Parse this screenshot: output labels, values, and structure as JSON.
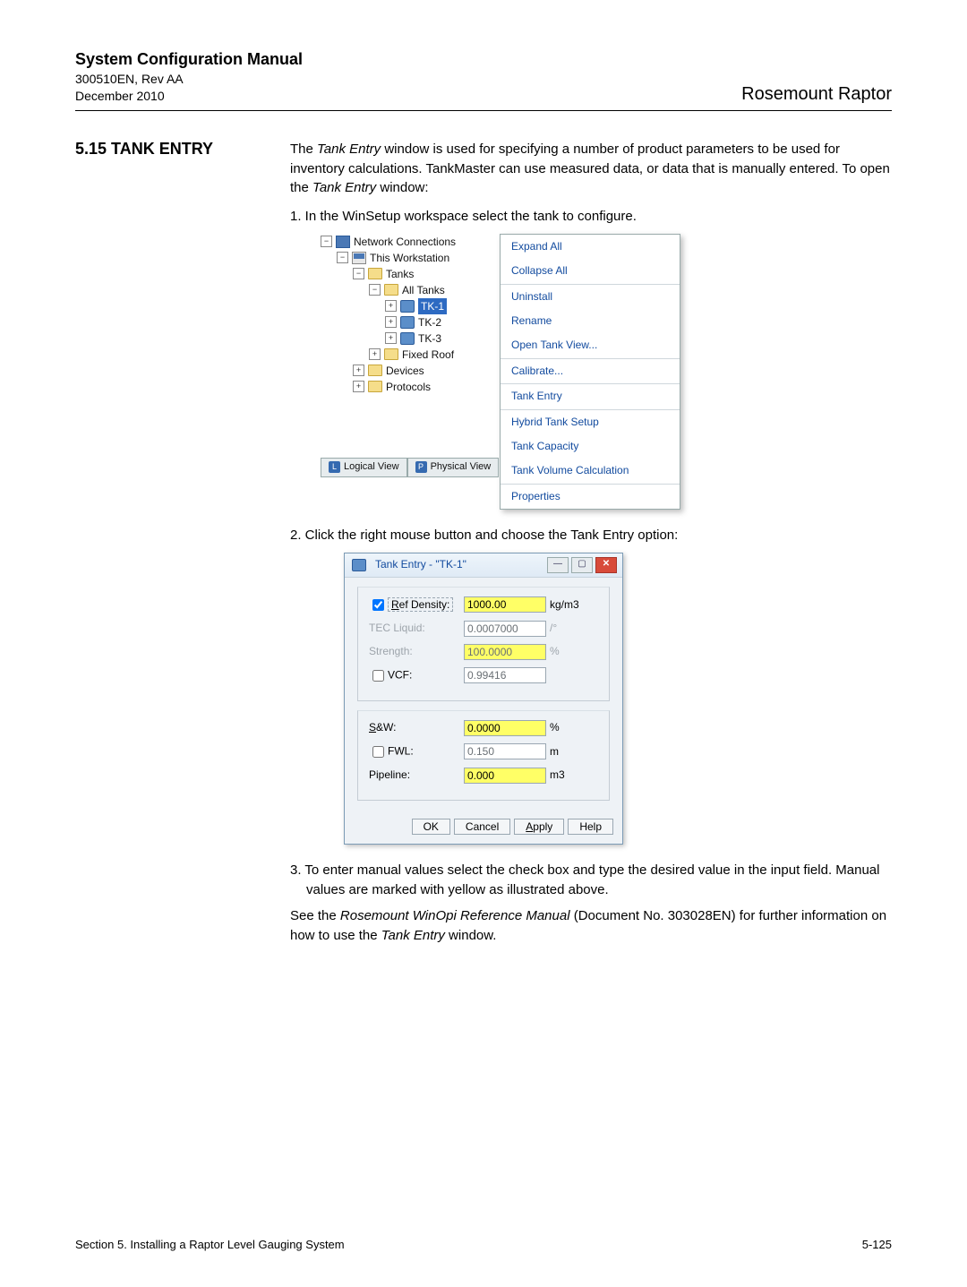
{
  "header": {
    "title": "System Configuration Manual",
    "doc_id": "300510EN, Rev AA",
    "date": "December 2010",
    "brand": "Rosemount Raptor"
  },
  "section": {
    "number_title": "5.15 TANK ENTRY",
    "intro1_a": "The ",
    "intro1_em": "Tank Entry",
    "intro1_b": " window is used for specifying a number of product parameters to be used for inventory calculations. TankMaster can use measured data, or data that is manually entered. To open the ",
    "intro1_em2": "Tank Entry",
    "intro1_c": " window:",
    "step1": "1.  In the WinSetup workspace select the tank to configure.",
    "step2": "2.  Click the right mouse button and choose the Tank Entry option:",
    "step3": "3.  To enter manual values select the check box and type the desired value in the input field. Manual values are marked with yellow as illustrated above.",
    "closing_a": "See the ",
    "closing_em": "Rosemount WinOpi Reference Manual",
    "closing_b": " (Document No. 303028EN) for further information on how to use the ",
    "closing_em2": "Tank Entry",
    "closing_c": " window."
  },
  "tree": {
    "root": "Network Connections",
    "ws": "This Workstation",
    "tanks": "Tanks",
    "alltanks": "All Tanks",
    "tk1": "TK-1",
    "tk2": "TK-2",
    "tk3": "TK-3",
    "fixed": "Fixed Roof",
    "devices": "Devices",
    "protocols": "Protocols",
    "tab_logical": "Logical View",
    "tab_physical": "Physical View",
    "badge_l": "L",
    "badge_p": "P"
  },
  "ctx": {
    "expand": "Expand All",
    "collapse": "Collapse All",
    "uninstall": "Uninstall",
    "rename": "Rename",
    "opentank": "Open Tank View...",
    "calibrate": "Calibrate...",
    "tankentry": "Tank Entry",
    "hybrid": "Hybrid Tank Setup",
    "capacity": "Tank Capacity",
    "volcalc": "Tank Volume Calculation",
    "properties": "Properties"
  },
  "dialog": {
    "title": "Tank Entry -  \"TK-1\"",
    "rows": {
      "refdensity_label": "Ref Density:",
      "refdensity_value": "1000.00",
      "refdensity_unit": "kg/m3",
      "tec_label": "TEC Liquid:",
      "tec_value": "0.0007000",
      "tec_unit": "/°",
      "strength_label": "Strength:",
      "strength_value": "100.0000",
      "strength_unit": "%",
      "vcf_label": "VCF:",
      "vcf_value": "0.99416",
      "sw_label": "S&W:",
      "sw_value": "0.0000",
      "sw_unit": "%",
      "fwl_label": "FWL:",
      "fwl_value": "0.150",
      "fwl_unit": "m",
      "pipe_label": "Pipeline:",
      "pipe_value": "0.000",
      "pipe_unit": "m3"
    },
    "buttons": {
      "ok": "OK",
      "cancel": "Cancel",
      "apply": "Apply",
      "help": "Help"
    }
  },
  "footer": {
    "left": "Section 5. Installing a Raptor Level Gauging System",
    "right": "5-125"
  }
}
